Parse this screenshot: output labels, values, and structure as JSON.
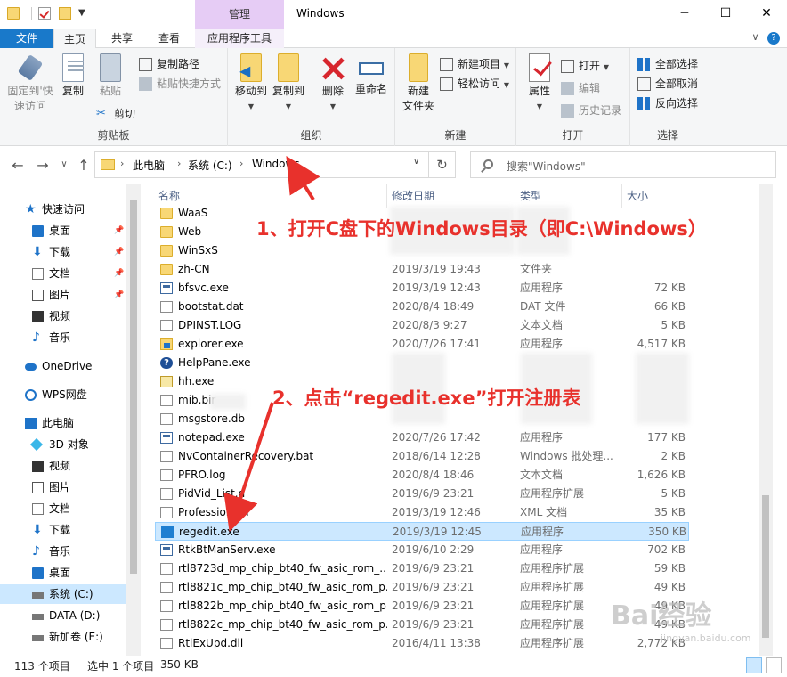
{
  "titlebar": {
    "manage_tab": "管理",
    "title": "Windows",
    "minimize": "─",
    "maximize": "☐",
    "close": "✕"
  },
  "ribbon_tabs": {
    "file": "文件",
    "home": "主页",
    "share": "共享",
    "view": "查看",
    "app_tools": "应用程序工具",
    "collapse": "∨"
  },
  "ribbon": {
    "clipboard": {
      "label": "剪贴板",
      "pin": "固定到快速访问",
      "pin_line1": "固定到'快",
      "pin_line2": "速访问",
      "copy": "复制",
      "paste": "粘贴",
      "copy_path": "复制路径",
      "paste_shortcut": "粘贴快捷方式",
      "cut": "剪切"
    },
    "organize": {
      "label": "组织",
      "move_to": "移动到",
      "copy_to": "复制到",
      "delete": "删除",
      "rename": "重命名"
    },
    "new": {
      "label": "新建",
      "new_folder_line1": "新建",
      "new_folder_line2": "文件夹",
      "new_item": "新建项目",
      "easy_access": "轻松访问"
    },
    "open": {
      "label": "打开",
      "properties": "属性",
      "open": "打开",
      "edit": "编辑",
      "history": "历史记录"
    },
    "select": {
      "label": "选择",
      "select_all": "全部选择",
      "select_none": "全部取消",
      "invert": "反向选择"
    }
  },
  "nav": {
    "back": "←",
    "forward": "→",
    "recent": "∨",
    "up": "↑",
    "breadcrumbs": [
      "此电脑",
      "系统 (C:)",
      "Windows"
    ],
    "refresh": "↻",
    "search_placeholder": "搜索\"Windows\""
  },
  "sidebar": {
    "items": [
      {
        "label": "快速访问",
        "icon": "star-icon",
        "pin": false
      },
      {
        "label": "桌面",
        "icon": "desktop-icon",
        "pin": true
      },
      {
        "label": "下载",
        "icon": "download-icon",
        "pin": true
      },
      {
        "label": "文档",
        "icon": "document-icon",
        "pin": true
      },
      {
        "label": "图片",
        "icon": "picture-icon",
        "pin": true
      },
      {
        "label": "视频",
        "icon": "video-icon",
        "pin": false
      },
      {
        "label": "音乐",
        "icon": "music-icon",
        "pin": false
      },
      {
        "label": "OneDrive",
        "icon": "cloud-icon",
        "pin": false
      },
      {
        "label": "WPS网盘",
        "icon": "wps-icon",
        "pin": false
      },
      {
        "label": "此电脑",
        "icon": "pc-icon",
        "pin": false
      },
      {
        "label": "3D 对象",
        "icon": "3d-icon",
        "pin": false
      },
      {
        "label": "视频",
        "icon": "video-icon",
        "pin": false
      },
      {
        "label": "图片",
        "icon": "picture-icon",
        "pin": false
      },
      {
        "label": "文档",
        "icon": "document-icon",
        "pin": false
      },
      {
        "label": "下载",
        "icon": "download-icon",
        "pin": false
      },
      {
        "label": "音乐",
        "icon": "music-icon",
        "pin": false
      },
      {
        "label": "桌面",
        "icon": "desktop-icon",
        "pin": false
      },
      {
        "label": "系统 (C:)",
        "icon": "drive-icon",
        "pin": false
      },
      {
        "label": "DATA (D:)",
        "icon": "drive-icon",
        "pin": false
      },
      {
        "label": "新加卷 (E:)",
        "icon": "drive-icon",
        "pin": false
      }
    ]
  },
  "columns": {
    "name": "名称",
    "date": "修改日期",
    "type": "类型",
    "size": "大小",
    "sort": "^"
  },
  "files": [
    {
      "name": "WaaS",
      "date": "",
      "type": "",
      "size": "",
      "icon": "folder"
    },
    {
      "name": "Web",
      "date": "",
      "type": "",
      "size": "",
      "icon": "folder"
    },
    {
      "name": "WinSxS",
      "date": "",
      "type": "",
      "size": "",
      "icon": "folder"
    },
    {
      "name": "zh-CN",
      "date": "2019/3/19 19:43",
      "type": "文件夹",
      "size": "",
      "icon": "folder"
    },
    {
      "name": "bfsvc.exe",
      "date": "2019/3/19 12:43",
      "type": "应用程序",
      "size": "72 KB",
      "icon": "exe"
    },
    {
      "name": "bootstat.dat",
      "date": "2020/8/4 18:49",
      "type": "DAT 文件",
      "size": "66 KB",
      "icon": "file"
    },
    {
      "name": "DPINST.LOG",
      "date": "2020/8/3 9:27",
      "type": "文本文档",
      "size": "5 KB",
      "icon": "file"
    },
    {
      "name": "explorer.exe",
      "date": "2020/7/26 17:41",
      "type": "应用程序",
      "size": "4,517 KB",
      "icon": "explorer"
    },
    {
      "name": "HelpPane.exe",
      "date": "",
      "type": "",
      "size": "",
      "icon": "help"
    },
    {
      "name": "hh.exe",
      "date": "",
      "type": "",
      "size": "",
      "icon": "hh"
    },
    {
      "name": "mib.bir",
      "date": "",
      "type": "",
      "size": "",
      "icon": "file"
    },
    {
      "name": "msgstore.db",
      "date": "",
      "type": "",
      "size": "",
      "icon": "file"
    },
    {
      "name": "notepad.exe",
      "date": "2020/7/26 17:42",
      "type": "应用程序",
      "size": "177 KB",
      "icon": "exe"
    },
    {
      "name": "NvContainerRecovery.bat",
      "date": "2018/6/14 12:28",
      "type": "Windows 批处理...",
      "size": "2 KB",
      "icon": "file"
    },
    {
      "name": "PFRO.log",
      "date": "2020/8/4 18:46",
      "type": "文本文档",
      "size": "1,626 KB",
      "icon": "file"
    },
    {
      "name": "PidVid_List.d",
      "date": "2019/6/9 23:21",
      "type": "应用程序扩展",
      "size": "5 KB",
      "icon": "file"
    },
    {
      "name": "Professio.xml",
      "date": "2019/3/19 12:46",
      "type": "XML 文档",
      "size": "35 KB",
      "icon": "file"
    },
    {
      "name": "regedit.exe",
      "date": "2019/3/19 12:45",
      "type": "应用程序",
      "size": "350 KB",
      "icon": "reg",
      "selected": true
    },
    {
      "name": "RtkBtManServ.exe",
      "date": "2019/6/10 2:29",
      "type": "应用程序",
      "size": "702 KB",
      "icon": "exe"
    },
    {
      "name": "rtl8723d_mp_chip_bt40_fw_asic_rom_...",
      "date": "2019/6/9 23:21",
      "type": "应用程序扩展",
      "size": "59 KB",
      "icon": "file"
    },
    {
      "name": "rtl8821c_mp_chip_bt40_fw_asic_rom_p...",
      "date": "2019/6/9 23:21",
      "type": "应用程序扩展",
      "size": "49 KB",
      "icon": "file"
    },
    {
      "name": "rtl8822b_mp_chip_bt40_fw_asic_rom_p...",
      "date": "2019/6/9 23:21",
      "type": "应用程序扩展",
      "size": "49 KB",
      "icon": "file"
    },
    {
      "name": "rtl8822c_mp_chip_bt40_fw_asic_rom_p...",
      "date": "2019/6/9 23:21",
      "type": "应用程序扩展",
      "size": "49 KB",
      "icon": "file"
    },
    {
      "name": "RtlExUpd.dll",
      "date": "2016/4/11 13:38",
      "type": "应用程序扩展",
      "size": "2,772 KB",
      "icon": "file"
    }
  ],
  "status": {
    "count": "113 个项目",
    "selected": "选中 1 个项目",
    "size": "350 KB"
  },
  "annotations": {
    "step1": "1、打开C盘下的Windows目录（即C:\\Windows）",
    "step2": "2、点击“regedit.exe”打开注册表",
    "color": "#e8312c"
  },
  "watermark": {
    "main": "Bai经验",
    "sub": "jingyan.baidu.com"
  }
}
